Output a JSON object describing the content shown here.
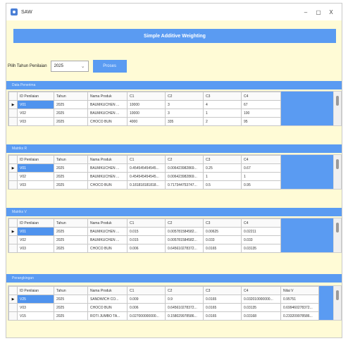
{
  "window": {
    "title": "SAW",
    "controls": {
      "minimize": "–",
      "maximize": "▢",
      "close": "X"
    }
  },
  "header": {
    "title": "Simple Additive Weighting"
  },
  "controls": {
    "year_label": "Pilih Tahun Penilaian",
    "year_value": "2025",
    "process_label": "Proses"
  },
  "colors": {
    "accent": "#5a9bf2",
    "background": "#fffbd6",
    "selected": "#4f93ee"
  },
  "icons": {
    "app": "saw-app-icon",
    "dropdown": "chevron-down-icon",
    "row_pointer": "row-pointer-icon"
  },
  "sections": [
    {
      "title": "Data Penerima",
      "columns": [
        "ID Penilaian",
        "Tahun",
        "Nama Produk",
        "C1",
        "C2",
        "C3",
        "C4"
      ],
      "rows": [
        [
          "V01",
          "2025",
          "BAUMKUCHEN ...",
          "10000",
          "3",
          "4",
          "67"
        ],
        [
          "V02",
          "2025",
          "BAUMKUCHEN ...",
          "10000",
          "3",
          "1",
          "100"
        ],
        [
          "V03",
          "2025",
          "CHOCO BUN",
          "4000",
          "335",
          "2",
          "95"
        ]
      ]
    },
    {
      "title": "Matriks R",
      "columns": [
        "ID Penilaian",
        "Tahun",
        "Nama Produk",
        "C1",
        "C2",
        "C3",
        "C4"
      ],
      "rows": [
        [
          "V01",
          "2025",
          "BAUMKUCHEN ...",
          "0.454545454545...",
          "0.006423982869...",
          "0.25",
          "0.67"
        ],
        [
          "V02",
          "2025",
          "BAUMKUCHEN ...",
          "0.454545454545...",
          "0.006423982869...",
          "1",
          "1"
        ],
        [
          "V03",
          "2025",
          "CHOCO BUN",
          "0.181818181818...",
          "0.717344753747...",
          "0.5",
          "0.95"
        ]
      ]
    },
    {
      "title": "Matriks V",
      "columns": [
        "ID Penilaian",
        "Tahun",
        "Nama Produk",
        "C1",
        "C2",
        "C3",
        "C4"
      ],
      "rows": [
        [
          "V01",
          "2025",
          "BAUMKUCHEN ...",
          "0.015",
          "0.005781584582...",
          "0.00625",
          "0.02211"
        ],
        [
          "V02",
          "2025",
          "BAUMKUCHEN ...",
          "0.015",
          "0.005781584582...",
          "0.033",
          "0.033"
        ],
        [
          "V03",
          "2025",
          "CHOCO BUN",
          "0.006",
          "0.645610278372...",
          "0.0165",
          "0.03135"
        ]
      ]
    },
    {
      "title": "Perangkingan",
      "columns": [
        "ID Penilaian",
        "Tahun",
        "Nama Produk",
        "C1",
        "C2",
        "C3",
        "C4",
        "Nilai V"
      ],
      "rows": [
        [
          "V25",
          "2025",
          "SANDWICH CO...",
          "0.009",
          "0.9",
          "0.0165",
          "0.032010000000...",
          "0.95751"
        ],
        [
          "V03",
          "2025",
          "CHOCO BUN",
          "0.006",
          "0.645610278372...",
          "0.0165",
          "0.03135",
          "0.699460278372..."
        ],
        [
          "V15",
          "2025",
          "ROTI JUMBO TA...",
          "0.027000000000...",
          "0.158029978586...",
          "0.0165",
          "0.03168",
          "0.233209978586..."
        ]
      ]
    }
  ]
}
